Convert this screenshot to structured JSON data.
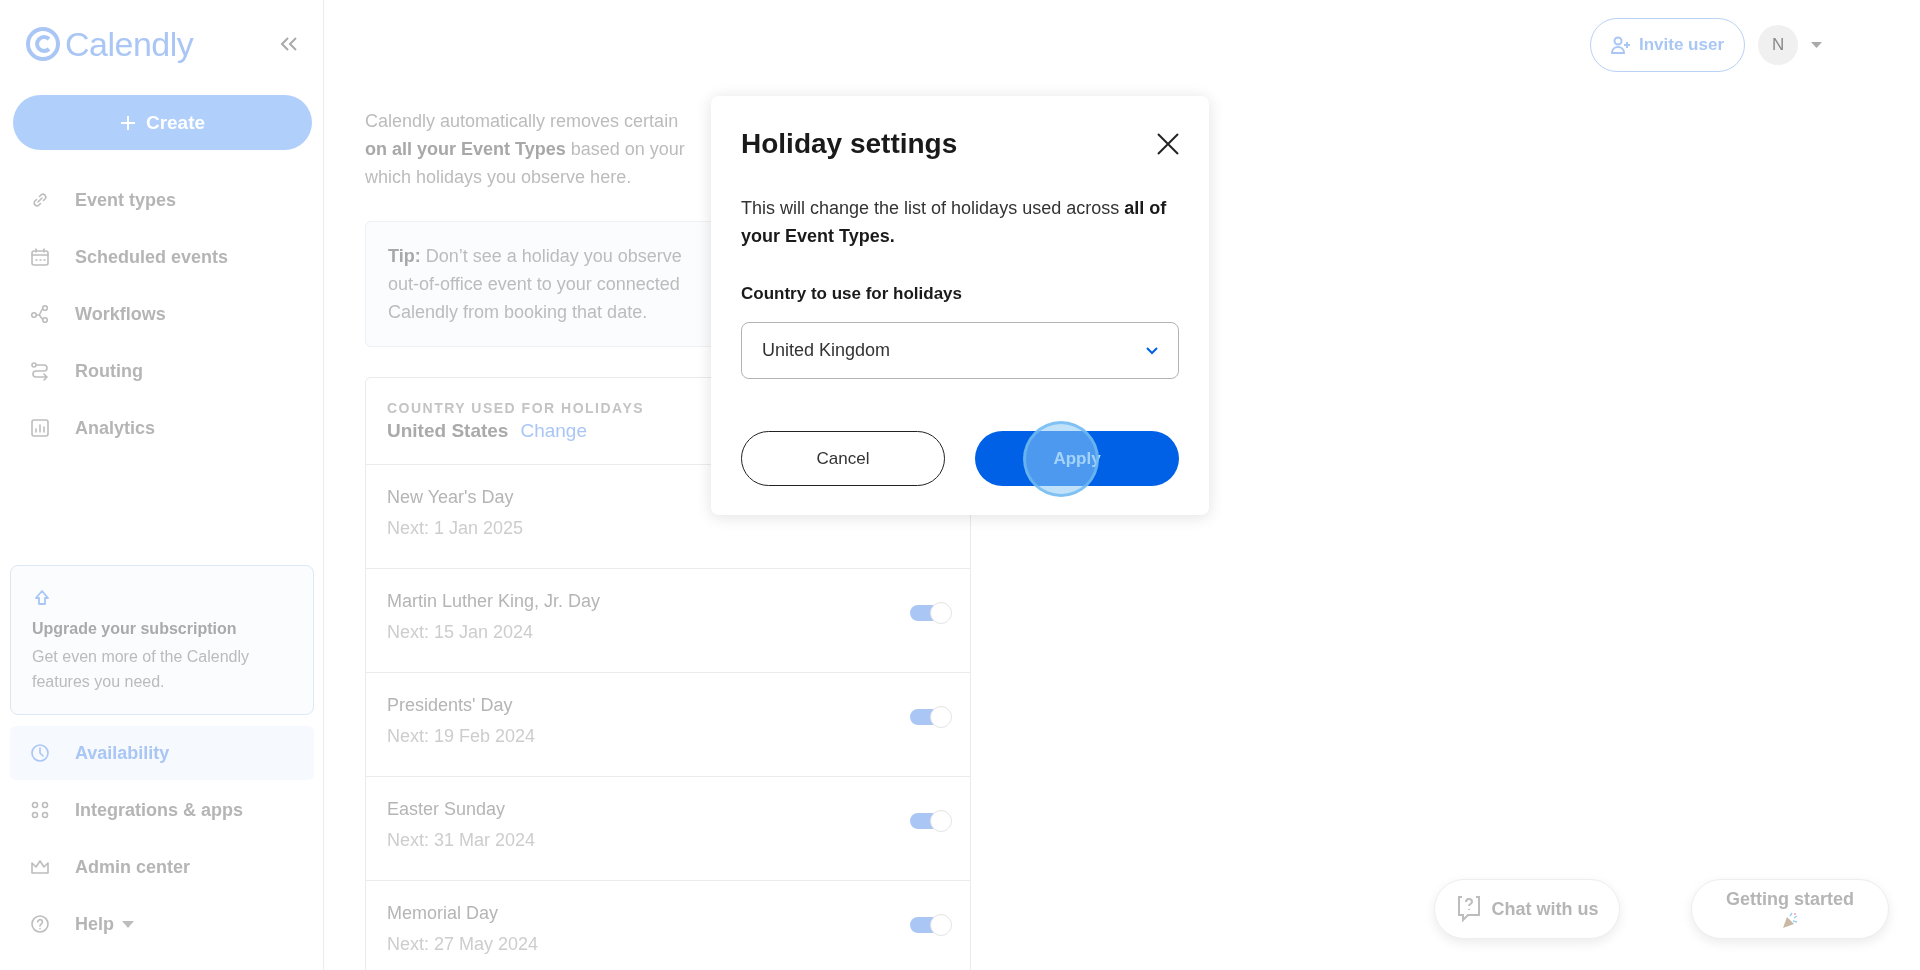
{
  "sidebar": {
    "brand": "Calendly",
    "create_button": "Create",
    "nav_top": [
      {
        "label": "Event types",
        "selected": false
      },
      {
        "label": "Scheduled events",
        "selected": false
      },
      {
        "label": "Workflows",
        "selected": false
      },
      {
        "label": "Routing",
        "selected": false
      },
      {
        "label": "Analytics",
        "selected": false
      }
    ],
    "upgrade": {
      "title": "Upgrade your subscription",
      "text": "Get even more of the Calendly features you need."
    },
    "nav_bottom": [
      {
        "label": "Availability",
        "selected": true
      },
      {
        "label": "Integrations & apps",
        "selected": false
      },
      {
        "label": "Admin center",
        "selected": false
      },
      {
        "label": "Help",
        "selected": false,
        "has_menu": true
      }
    ]
  },
  "header": {
    "invite_button": "Invite user",
    "avatar": "N"
  },
  "main": {
    "intro": [
      "Calendly automatically removes certain",
      "**on all your Event Types** based on your",
      "which holidays you observe here."
    ],
    "tip": [
      "**Tip:** Don’t see a holiday you observe",
      "out-of-office event to your connected",
      "Calendly from booking that date."
    ],
    "holidays": {
      "header_label": "COUNTRY USED FOR HOLIDAYS",
      "country": "United States",
      "change_link": "Change",
      "items": [
        {
          "name": "New Year's Day",
          "next": "Next: 1 Jan 2025"
        },
        {
          "name": "Martin Luther King, Jr. Day",
          "next": "Next: 15 Jan 2024",
          "on": true
        },
        {
          "name": "Presidents' Day",
          "next": "Next: 19 Feb 2024",
          "on": true
        },
        {
          "name": "Easter Sunday",
          "next": "Next: 31 Mar 2024",
          "on": true
        },
        {
          "name": "Memorial Day",
          "next": "Next: 27 May 2024",
          "on": true
        }
      ]
    }
  },
  "modal": {
    "title": "Holiday settings",
    "body": "This will change the list of holidays used across **all of your Event Types.**",
    "field_label": "Country to use for holidays",
    "country_value": "United Kingdom",
    "cancel_button": "Cancel",
    "apply_button": "Apply"
  },
  "floating": {
    "chat_button": "Chat with us",
    "getting_started_button": "Getting started"
  }
}
